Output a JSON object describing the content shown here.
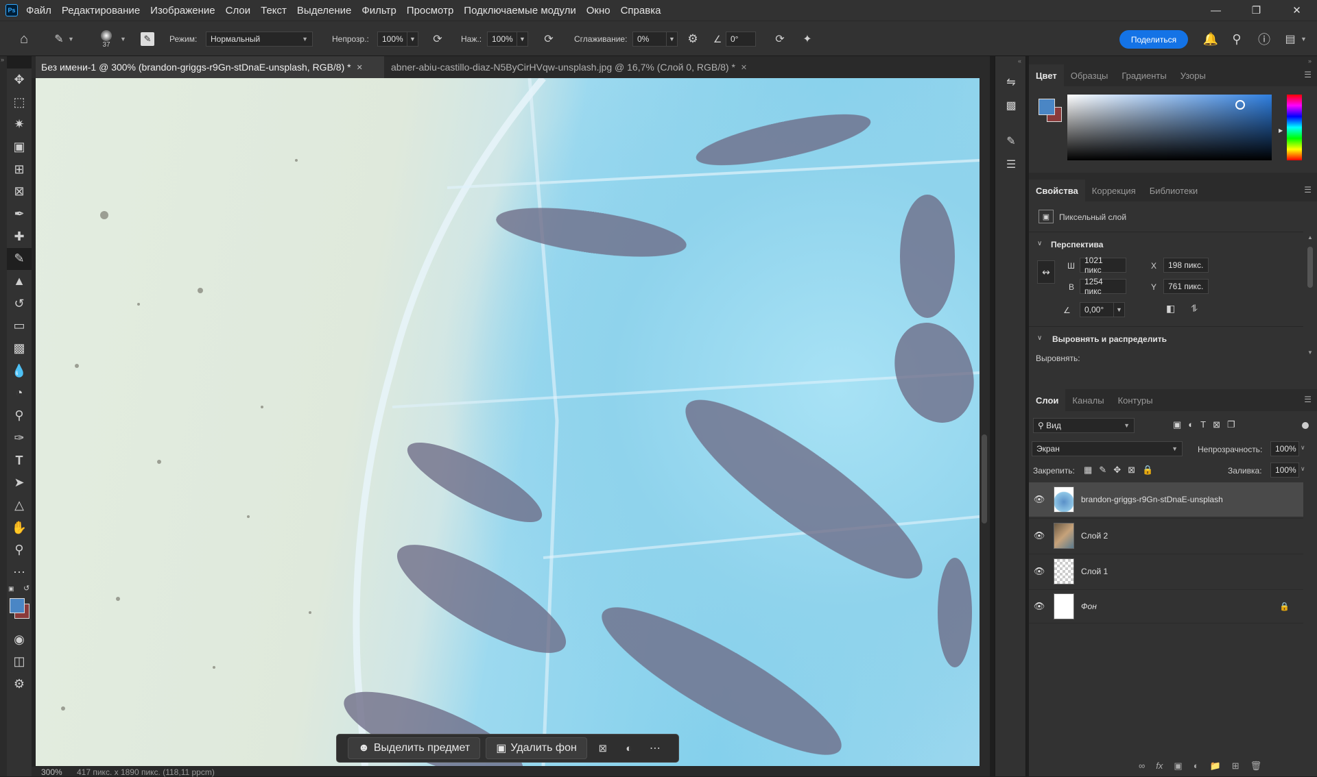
{
  "app": {
    "logo": "Ps"
  },
  "menu": [
    "Файл",
    "Редактирование",
    "Изображение",
    "Слои",
    "Текст",
    "Выделение",
    "Фильтр",
    "Просмотр",
    "Подключаемые модули",
    "Окно",
    "Справка"
  ],
  "options": {
    "brush_size": "37",
    "mode_label": "Режим:",
    "mode_value": "Нормальный",
    "opacity_label": "Непрозр.:",
    "opacity_value": "100%",
    "pressure_label": "Наж.:",
    "pressure_value": "100%",
    "smoothing_label": "Сглаживание:",
    "smoothing_value": "0%",
    "angle_value": "0°",
    "share_label": "Поделиться"
  },
  "documents": [
    {
      "title": "Без имени-1 @ 300% (brandon-griggs-r9Gn-stDnaE-unsplash, RGB/8) *",
      "active": true
    },
    {
      "title": "abner-abiu-castillo-diaz-N5ByCirHVqw-unsplash.jpg @ 16,7% (Слой 0, RGB/8) *",
      "active": false
    }
  ],
  "status": {
    "zoom": "300%",
    "info": "417 пикс. x 1890 пикс. (118,11 ppcm)"
  },
  "context_bar": {
    "select_subject": "Выделить предмет",
    "remove_bg": "Удалить фон"
  },
  "color_panel": {
    "tabs": [
      "Цвет",
      "Образцы",
      "Градиенты",
      "Узоры"
    ],
    "foreground": "#4a86c5",
    "background": "#8a3a3a"
  },
  "properties_panel": {
    "tabs": [
      "Свойства",
      "Коррекция",
      "Библиотеки"
    ],
    "layer_type": "Пиксельный слой",
    "transform_header": "Перспектива",
    "w_label": "Ш",
    "w_value": "1021 пикс",
    "h_label": "В",
    "h_value": "1254 пикс",
    "x_label": "X",
    "x_value": "198 пикс.",
    "y_label": "Y",
    "y_value": "761 пикс.",
    "angle_value": "0,00°",
    "align_header": "Выровнять и распределить",
    "align_label": "Выровнять:"
  },
  "layers_panel": {
    "tabs": [
      "Слои",
      "Каналы",
      "Контуры"
    ],
    "filter_value": "Вид",
    "blend_mode": "Экран",
    "opacity_label": "Непрозрачность:",
    "opacity_value": "100%",
    "lock_label": "Закрепить:",
    "fill_label": "Заливка:",
    "fill_value": "100%",
    "layers": [
      {
        "name": "brandon-griggs-r9Gn-stDnaE-unsplash",
        "selected": true
      },
      {
        "name": "Слой 2",
        "selected": false
      },
      {
        "name": "Слой 1",
        "selected": false
      },
      {
        "name": "Фон",
        "selected": false,
        "locked": true
      }
    ]
  }
}
